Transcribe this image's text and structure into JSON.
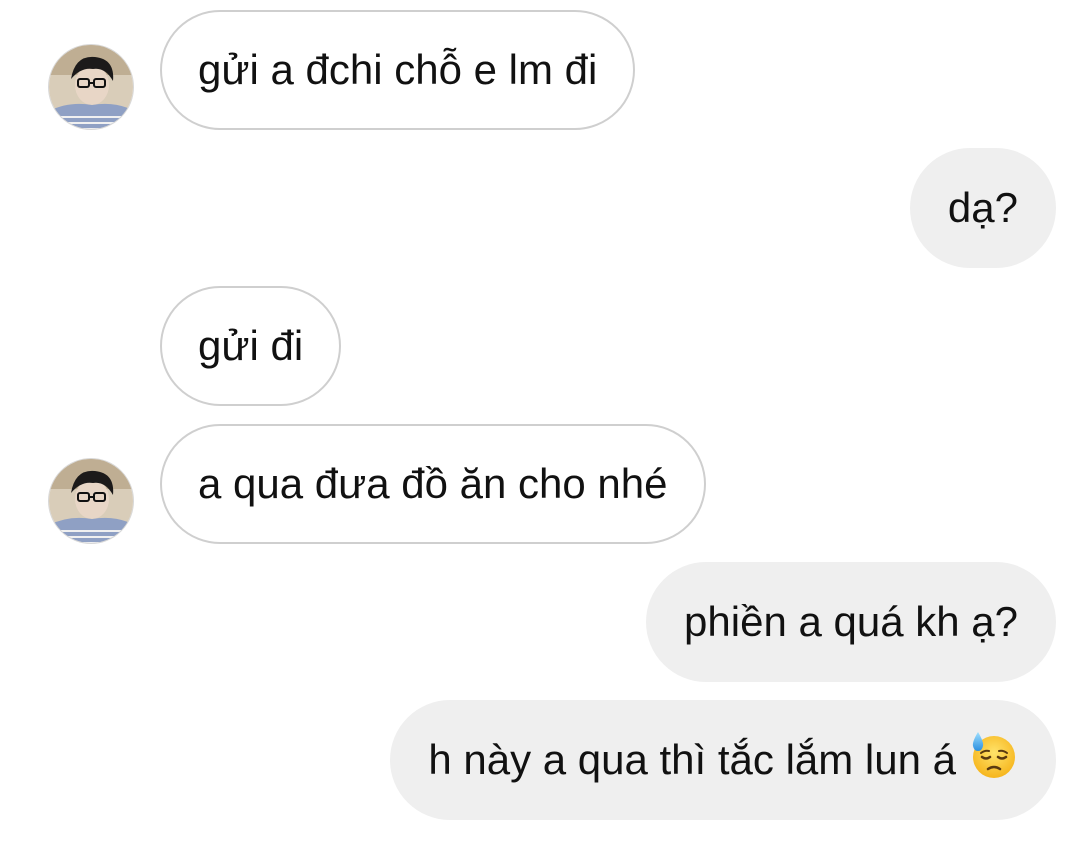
{
  "conversation": {
    "messages": [
      {
        "sender": "them",
        "text": "gửi a đchi chỗ e lm đi",
        "show_avatar": true
      },
      {
        "sender": "me",
        "text": "dạ?"
      },
      {
        "sender": "them",
        "text": "gửi đi",
        "show_avatar": false
      },
      {
        "sender": "them",
        "text": "a qua đưa đồ ăn cho nhé",
        "show_avatar": true
      },
      {
        "sender": "me",
        "text": "phiền a quá kh ạ?"
      },
      {
        "sender": "me",
        "text": "h này a qua thì tắc lắm lun á",
        "emoji": "downcast-face-with-sweat-icon"
      }
    ]
  },
  "colors": {
    "incoming_border": "#cfcfcf",
    "incoming_bg": "#ffffff",
    "outgoing_bg": "#efefef",
    "text": "#111111"
  }
}
